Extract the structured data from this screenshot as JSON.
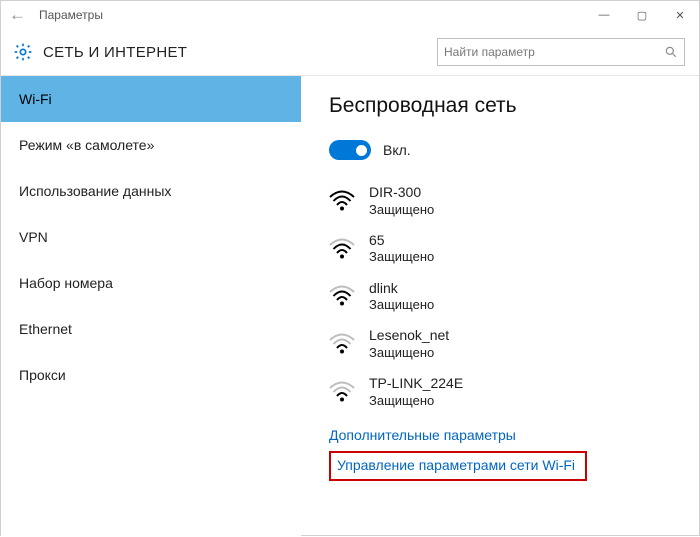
{
  "window": {
    "title": "Параметры"
  },
  "header": {
    "title": "СЕТЬ И ИНТЕРНЕТ",
    "search_placeholder": "Найти параметр"
  },
  "sidebar": {
    "items": [
      {
        "label": "Wi-Fi",
        "active": true
      },
      {
        "label": "Режим «в самолете»"
      },
      {
        "label": "Использование данных"
      },
      {
        "label": "VPN"
      },
      {
        "label": "Набор номера"
      },
      {
        "label": "Ethernet"
      },
      {
        "label": "Прокси"
      }
    ]
  },
  "main": {
    "title": "Беспроводная сеть",
    "toggle_label": "Вкл.",
    "toggle_on": true,
    "networks": [
      {
        "name": "DIR-300",
        "status": "Защищено",
        "signal": "strong"
      },
      {
        "name": "65",
        "status": "Защищено",
        "signal": "med"
      },
      {
        "name": "dlink",
        "status": "Защищено",
        "signal": "med"
      },
      {
        "name": "Lesenok_net",
        "status": "Защищено",
        "signal": "weak"
      },
      {
        "name": "TP-LINK_224E",
        "status": "Защищено",
        "signal": "weak"
      }
    ],
    "link_advanced": "Дополнительные параметры",
    "link_manage": "Управление параметрами сети Wi-Fi"
  }
}
